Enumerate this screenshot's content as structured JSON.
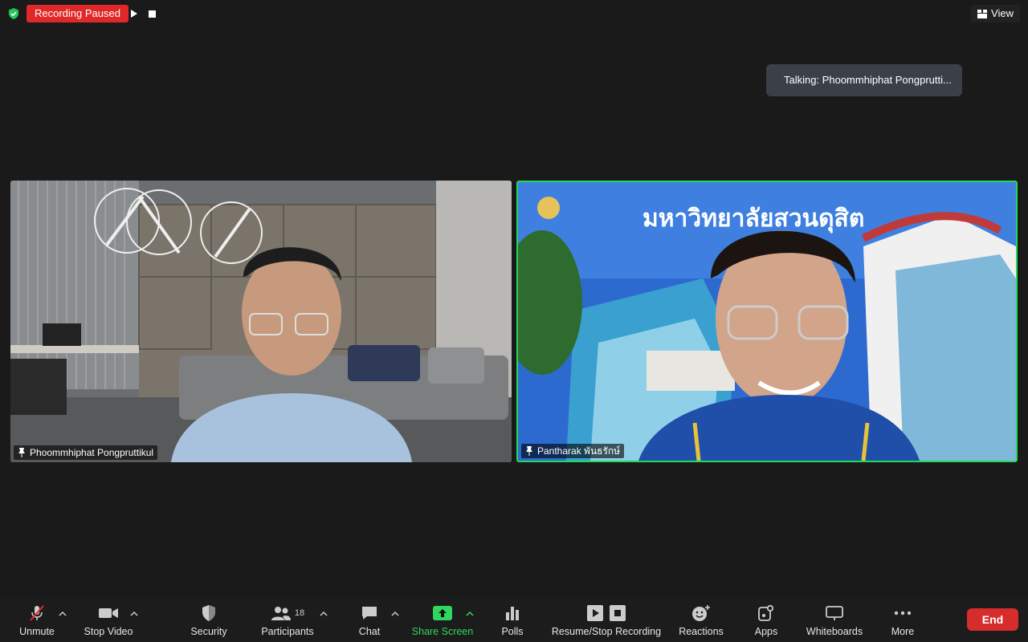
{
  "recording": {
    "status": "Recording Paused"
  },
  "view": {
    "label": "View"
  },
  "talking": {
    "text": "Talking: Phoommhiphat Pongprutti..."
  },
  "participants_tiles": [
    {
      "name": "Phoommhiphat Pongpruttikul"
    },
    {
      "name": "Pantharak พันธรักษ์",
      "background_text": "มหาวิทยาลัยสวนดุสิต"
    }
  ],
  "toolbar": {
    "unmute": "Unmute",
    "stop_video": "Stop Video",
    "security": "Security",
    "participants": "Participants",
    "participants_count": "18",
    "chat": "Chat",
    "share_screen": "Share Screen",
    "polls": "Polls",
    "recording": "Resume/Stop Recording",
    "reactions": "Reactions",
    "apps": "Apps",
    "whiteboards": "Whiteboards",
    "more": "More",
    "end": "End"
  },
  "colors": {
    "recording_red": "#e02828",
    "active_speaker": "#23d959",
    "share_green": "#2ed85c",
    "end_red": "#d62c2c"
  }
}
